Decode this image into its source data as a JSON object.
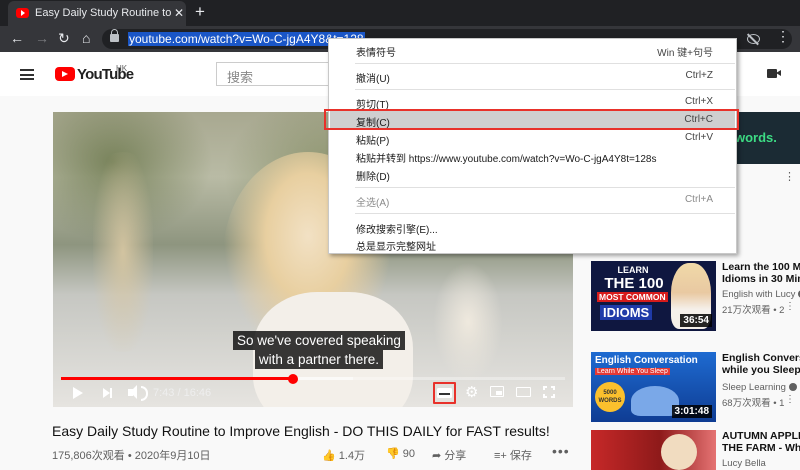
{
  "browser": {
    "tab_title": "Easy Daily Study Routine to Im",
    "tab_close": "✕",
    "new_tab": "+",
    "back": "←",
    "forward": "→",
    "reload": "↻",
    "home": "⌂",
    "url": "youtube.com/watch?v=Wo-C-jgA4Y8&t=128",
    "menu": "⋮"
  },
  "header": {
    "logo": "YouTube",
    "region": "HK",
    "search_placeholder": "搜索"
  },
  "player": {
    "subtitle_line1": "So we've covered speaking",
    "subtitle_line2": "with a partner there.",
    "time": "7:43 / 16:46",
    "progress_played": 0.46,
    "progress_loaded": 0.58
  },
  "video": {
    "title": "Easy Daily Study Routine to Improve English - DO THIS DAILY for FAST results!",
    "meta": "175,806次观看 • 2020年9月10日",
    "likes": "1.4万",
    "dislikes": "90",
    "share_label": "分享",
    "save_label": "保存",
    "more": "•••"
  },
  "ad": {
    "text": "words.",
    "more": "⋮"
  },
  "recommendations": [
    {
      "title_line1": "Learn the 100 Mo",
      "title_line2": "Idioms in 30 Min",
      "channel": "English with Lucy",
      "views": "21万次观看 • 2",
      "duration": "36:54",
      "thumb_text1": "LEARN",
      "thumb_text2": "THE 100",
      "thumb_text3": "MOST COMMON",
      "thumb_text4": "IDIOMS"
    },
    {
      "title_line1": "English Conversa",
      "title_line2": "while you Sleep",
      "channel": "Sleep Learning",
      "views": "68万次观看 • 1",
      "duration": "3:01:48",
      "thumb_text1": "English Conversation",
      "thumb_text2": "Learn While You Sleep",
      "thumb_text3": "5000 WORDS"
    },
    {
      "title_line1": "AUTUMN APPLE",
      "title_line2": "THE FARM - Wha",
      "channel": "Lucy Bella"
    }
  ],
  "context_menu": {
    "items": [
      {
        "label": "表情符号",
        "shortcut": "Win 键+句号"
      },
      {
        "label": "撤消(U)",
        "shortcut": "Ctrl+Z"
      },
      {
        "label": "剪切(T)",
        "shortcut": "Ctrl+X"
      },
      {
        "label": "复制(C)",
        "shortcut": "Ctrl+C"
      },
      {
        "label": "粘贴(P)",
        "shortcut": "Ctrl+V"
      },
      {
        "label": "粘贴并转到 https://www.youtube.com/watch?v=Wo-C-jgA4Y8t=128s",
        "shortcut": ""
      },
      {
        "label": "删除(D)",
        "shortcut": ""
      },
      {
        "label": "全选(A)",
        "shortcut": "Ctrl+A"
      },
      {
        "label": "修改搜索引擎(E)...",
        "shortcut": ""
      },
      {
        "label": "总是显示完整网址",
        "shortcut": ""
      }
    ]
  },
  "colors": {
    "accent_red": "#ff0000",
    "highlight_box": "#e8312a",
    "url_selection": "#1a56c7"
  }
}
